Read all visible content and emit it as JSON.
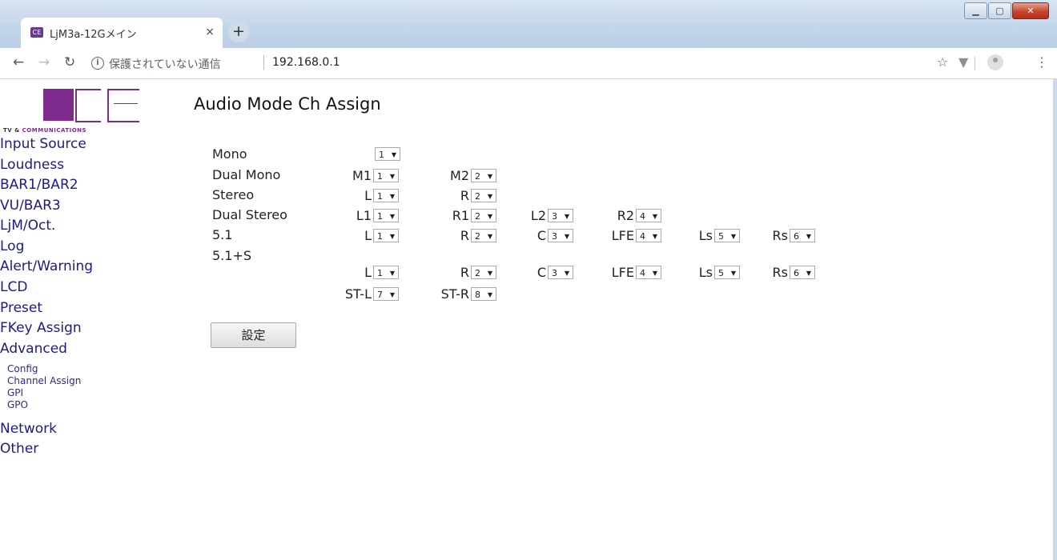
{
  "browser": {
    "tab_title": "LjM3a-12Gメイン",
    "tab_favicon_text": "CE",
    "tab_close": "×",
    "new_tab": "+",
    "address_security": "保護されていない通信",
    "address_url": "192.168.0.1"
  },
  "logo": {
    "tagline_tv": "TV &",
    "tagline_rest": "COMMUNICATIONS"
  },
  "sidebar": {
    "items": [
      {
        "label": "Input Source"
      },
      {
        "label": "Loudness"
      },
      {
        "label": "BAR1/BAR2"
      },
      {
        "label": "VU/BAR3"
      },
      {
        "label": "LjM/Oct."
      },
      {
        "label": "Log"
      },
      {
        "label": "Alert/Warning"
      },
      {
        "label": "LCD"
      },
      {
        "label": "Preset"
      },
      {
        "label": "FKey Assign"
      },
      {
        "label": "Advanced"
      }
    ],
    "advanced_sub": [
      {
        "label": "Config"
      },
      {
        "label": "Channel Assign"
      },
      {
        "label": "GPI"
      },
      {
        "label": "GPO"
      }
    ],
    "bottom_items": [
      {
        "label": "Network"
      },
      {
        "label": "Other"
      }
    ]
  },
  "main": {
    "title": "Audio Mode Ch Assign",
    "rows": [
      {
        "mode": "Mono",
        "channels": [
          {
            "label": "",
            "value": "1"
          }
        ]
      },
      {
        "mode": "Dual Mono",
        "channels": [
          {
            "label": "M1",
            "value": "1"
          },
          {
            "label": "M2",
            "value": "2"
          }
        ]
      },
      {
        "mode": "Stereo",
        "channels": [
          {
            "label": "L",
            "value": "1"
          },
          {
            "label": "R",
            "value": "2"
          }
        ]
      },
      {
        "mode": "Dual Stereo",
        "channels": [
          {
            "label": "L1",
            "value": "1"
          },
          {
            "label": "R1",
            "value": "2"
          },
          {
            "label": "L2",
            "value": "3"
          },
          {
            "label": "R2",
            "value": "4"
          }
        ]
      },
      {
        "mode": "5.1",
        "channels": [
          {
            "label": "L",
            "value": "1"
          },
          {
            "label": "R",
            "value": "2"
          },
          {
            "label": "C",
            "value": "3"
          },
          {
            "label": "LFE",
            "value": "4"
          },
          {
            "label": "Ls",
            "value": "5"
          },
          {
            "label": "Rs",
            "value": "6"
          }
        ]
      },
      {
        "mode": "5.1+S",
        "channels": [
          {
            "label": "L",
            "value": "1"
          },
          {
            "label": "R",
            "value": "2"
          },
          {
            "label": "C",
            "value": "3"
          },
          {
            "label": "LFE",
            "value": "4"
          },
          {
            "label": "Ls",
            "value": "5"
          },
          {
            "label": "Rs",
            "value": "6"
          }
        ]
      },
      {
        "mode": "",
        "channels": [
          {
            "label": "ST-L",
            "value": "7"
          },
          {
            "label": "ST-R",
            "value": "8"
          }
        ]
      }
    ],
    "submit_label": "設定"
  }
}
